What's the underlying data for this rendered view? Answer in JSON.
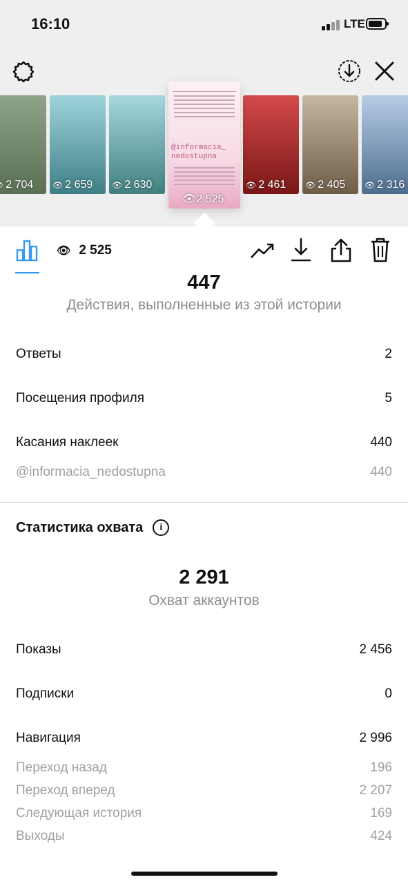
{
  "status_bar": {
    "time": "16:10",
    "network": "LTE"
  },
  "stories": [
    {
      "views": "2 704",
      "colors": [
        "#8fa48a",
        "#5b6f55"
      ]
    },
    {
      "views": "2 659",
      "colors": [
        "#9ed4dc",
        "#3f7f86"
      ]
    },
    {
      "views": "2 630",
      "colors": [
        "#a7d8e0",
        "#41807f"
      ]
    },
    {
      "views": "2 525",
      "colors": [
        "#f6d9e3",
        "#e3a6bf"
      ],
      "selected": true,
      "label": "@informacia_\nnedostupna"
    },
    {
      "views": "2 461",
      "colors": [
        "#d44a4a",
        "#7a1717"
      ]
    },
    {
      "views": "2 405",
      "colors": [
        "#c7b7a0",
        "#6d5c48"
      ]
    },
    {
      "views": "2 316",
      "colors": [
        "#b7cde6",
        "#4d6d8f"
      ]
    }
  ],
  "action_bar": {
    "views": "2 525"
  },
  "interactions": {
    "total": "447",
    "caption": "Действия, выполненные из этой истории",
    "rows": [
      {
        "label": "Ответы",
        "value": "2"
      },
      {
        "label": "Посещения профиля",
        "value": "5"
      },
      {
        "label": "Касания наклеек",
        "value": "440"
      }
    ],
    "sub_rows": [
      {
        "label": "@informacia_nedostupna",
        "value": "440"
      }
    ]
  },
  "reach": {
    "title": "Статистика охвата",
    "total": "2 291",
    "caption": "Охват аккаунтов",
    "rows": [
      {
        "label": "Показы",
        "value": "2 456"
      },
      {
        "label": "Подписки",
        "value": "0"
      },
      {
        "label": "Навигация",
        "value": "2 996"
      }
    ],
    "sub_rows": [
      {
        "label": "Переход назад",
        "value": "196"
      },
      {
        "label": "Переход вперед",
        "value": "2 207"
      },
      {
        "label": "Следующая история",
        "value": "169"
      },
      {
        "label": "Выходы",
        "value": "424"
      }
    ]
  },
  "accent_color": "#3897f0"
}
